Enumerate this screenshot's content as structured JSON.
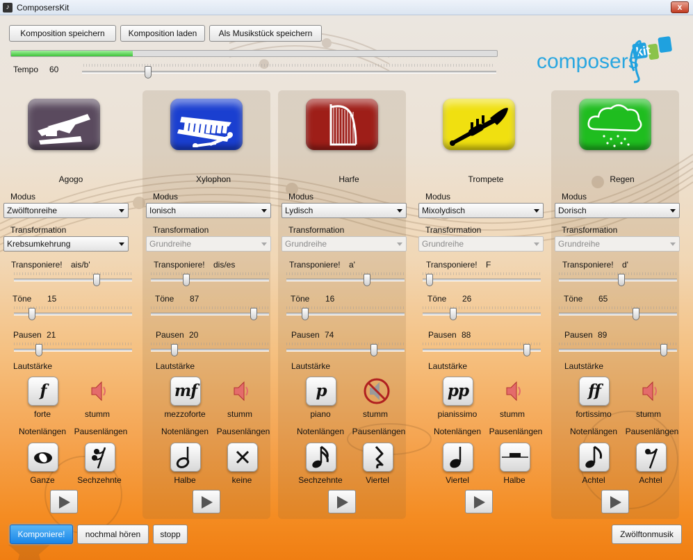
{
  "window": {
    "title": "ComposersKit",
    "close": "x"
  },
  "toolbar": {
    "save_label": "Komposition speichern",
    "load_label": "Komposition laden",
    "save_piece_label": "Als Musikstück speichern"
  },
  "progress": {
    "fraction": 0.25
  },
  "tempo": {
    "label": "Tempo",
    "value": "60",
    "fraction": 0.16
  },
  "logo": {
    "text_main": "composers",
    "text_accent": "kit"
  },
  "labels": {
    "mode": "Modus",
    "transformation": "Transformation",
    "transpose": "Transponiere!",
    "tones": "Töne",
    "pauses": "Pausen",
    "volume": "Lautstärke",
    "note_lengths": "Notenlängen",
    "pause_lengths": "Pausenlängen"
  },
  "instruments": [
    {
      "name": "Agogo",
      "color": "#5a4a5e",
      "icon": "agogo-icon",
      "mode": "Zwölftonreihe",
      "transformation": "Krebsumkehrung",
      "transformation_enabled": true,
      "transpose": "ais/b'",
      "transpose_pos": 0.7,
      "tones": "15",
      "tones_pos": 0.15,
      "pauses": "21",
      "pauses_pos": 0.21,
      "dynamic": "f",
      "dynamic_label": "forte",
      "mute_label": "stumm",
      "muted": false,
      "note_length": "Ganze",
      "note_icon": "whole-note-icon",
      "pause_length": "Sechzehnte",
      "pause_icon": "sixteenth-rest-icon"
    },
    {
      "name": "Xylophon",
      "color": "#1a3fd0",
      "icon": "xylophone-icon",
      "mode": "Ionisch",
      "transformation": "Grundreihe",
      "transformation_enabled": false,
      "transpose": "dis/es",
      "transpose_pos": 0.3,
      "tones": "87",
      "tones_pos": 0.87,
      "pauses": "20",
      "pauses_pos": 0.2,
      "dynamic": "mf",
      "dynamic_label": "mezzoforte",
      "mute_label": "stumm",
      "muted": false,
      "note_length": "Halbe",
      "note_icon": "half-note-icon",
      "pause_length": "keine",
      "pause_icon": "no-rest-icon"
    },
    {
      "name": "Harfe",
      "color": "#9e1e18",
      "icon": "harp-icon",
      "mode": "Lydisch",
      "transformation": "Grundreihe",
      "transformation_enabled": false,
      "transpose": "a'",
      "transpose_pos": 0.68,
      "tones": "16",
      "tones_pos": 0.16,
      "pauses": "74",
      "pauses_pos": 0.74,
      "dynamic": "p",
      "dynamic_label": "piano",
      "mute_label": "stumm",
      "muted": true,
      "note_length": "Sechzehnte",
      "note_icon": "sixteenth-note-icon",
      "pause_length": "Viertel",
      "pause_icon": "quarter-rest-icon"
    },
    {
      "name": "Trompete",
      "color": "#f0e010",
      "icon": "trumpet-icon",
      "mode": "Mixolydisch",
      "transformation": "Grundreihe",
      "transformation_enabled": false,
      "transpose": "F",
      "transpose_pos": 0.06,
      "tones": "26",
      "tones_pos": 0.26,
      "pauses": "88",
      "pauses_pos": 0.88,
      "dynamic": "pp",
      "dynamic_label": "pianissimo",
      "mute_label": "stumm",
      "muted": false,
      "note_length": "Viertel",
      "note_icon": "quarter-note-icon",
      "pause_length": "Halbe",
      "pause_icon": "half-rest-icon"
    },
    {
      "name": "Regen",
      "color": "#1fbd1f",
      "icon": "rain-cloud-icon",
      "mode": "Dorisch",
      "transformation": "Grundreihe",
      "transformation_enabled": false,
      "transpose": "d'",
      "transpose_pos": 0.53,
      "tones": "65",
      "tones_pos": 0.65,
      "pauses": "89",
      "pauses_pos": 0.89,
      "dynamic": "ff",
      "dynamic_label": "fortissimo",
      "mute_label": "stumm",
      "muted": false,
      "note_length": "Achtel",
      "note_icon": "eighth-note-icon",
      "pause_length": "Achtel",
      "pause_icon": "eighth-rest-icon"
    }
  ],
  "footer": {
    "compose_label": "Komponiere!",
    "replay_label": "nochmal hören",
    "stop_label": "stopp",
    "twelve_tone_label": "Zwölftonmusik"
  }
}
